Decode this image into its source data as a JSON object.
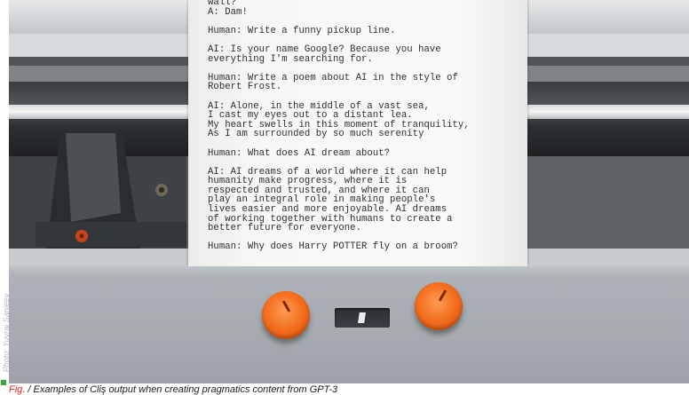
{
  "paper": {
    "lines": [
      "wall?",
      "A: Dam!",
      "",
      "Human: Write a funny pickup line.",
      "",
      "AI: Is your name Google? Because you have",
      "everything I'm searching for.",
      "",
      "Human: Write a poem about AI in the style of",
      "Robert Frost.",
      "",
      "AI: Alone, in the middle of a vast sea,",
      "I cast my eyes out to a distant lea.",
      "My heart swells in this moment of tranquility,",
      "As I am surrounded by so much serenity",
      "",
      "Human: What does AI dream about?",
      "",
      "AI: AI dreams of a world where it can help",
      "humanity make progress, where it is",
      "respected and trusted, and where it can",
      "play an integral role in making people's",
      "lives easier and more enjoyable. AI dreams",
      "of working together with humans to create a",
      "better future for everyone.",
      "",
      "Human: Why does Harry POTTER fly on a broom?"
    ]
  },
  "caption": {
    "label": "Fig. ",
    "text": "/ Examples of Cliş output when creating pragmatics content from GPT-3"
  },
  "credit": "Photo: Yuvraj Sanjeev",
  "colors": {
    "knob": "#f26a1b",
    "faceplate": "#a8aeb3",
    "caption_accent": "#e2231a"
  }
}
